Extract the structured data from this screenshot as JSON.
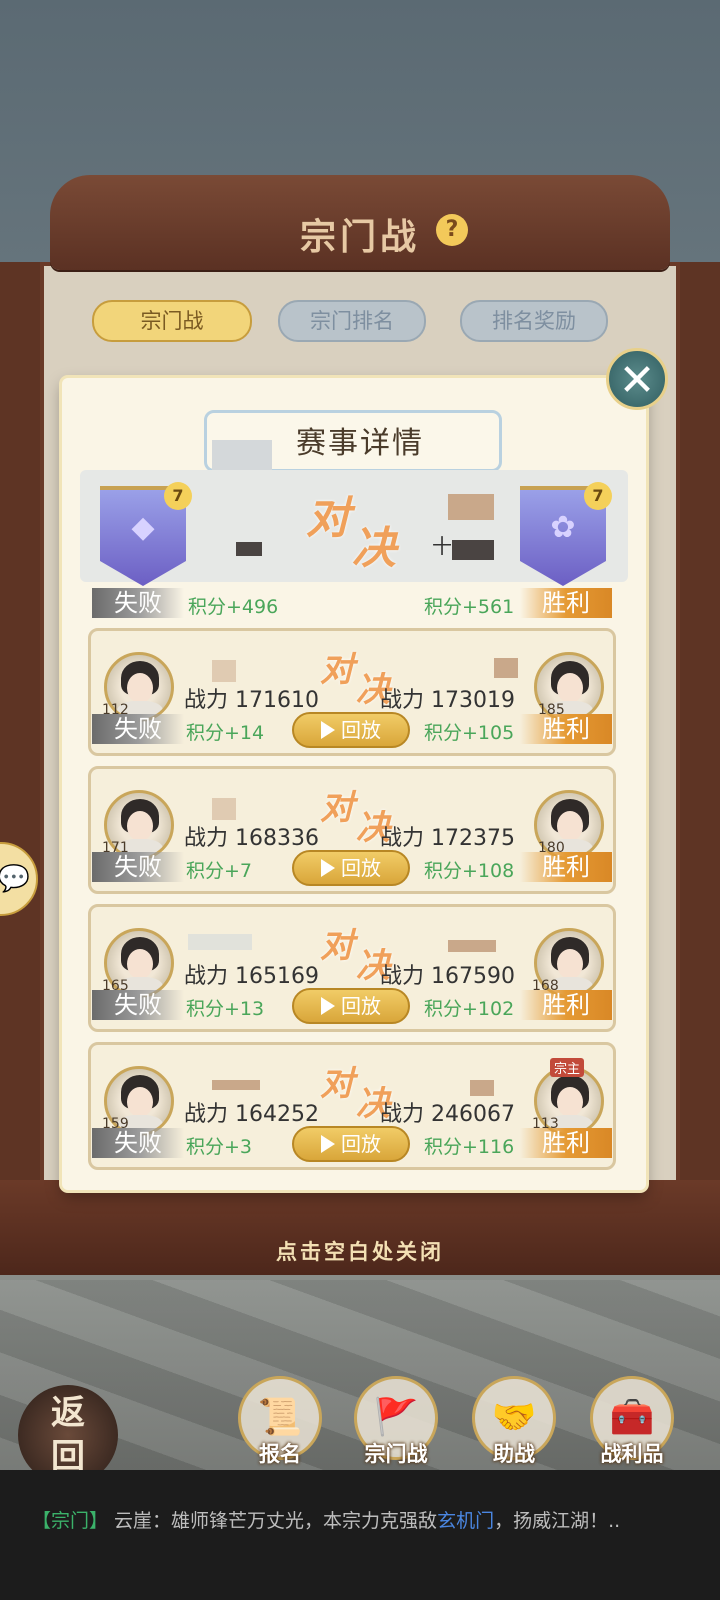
{
  "header": {
    "title": "宗门战",
    "help": "?"
  },
  "tabs": [
    {
      "label": "宗门战",
      "active": true
    },
    {
      "label": "宗门排名",
      "active": false
    },
    {
      "label": "排名奖励",
      "active": false
    }
  ],
  "dialog": {
    "title": "赛事详情",
    "close_hint": "点击空白处关闭",
    "summary": {
      "left": {
        "level": "7",
        "result": "失败",
        "points": "积分+496"
      },
      "right": {
        "level": "7",
        "result": "胜利",
        "points": "积分+561"
      },
      "vs_a": "对",
      "vs_b": "决",
      "right_name_fragment": "十"
    },
    "replay_label": "回放",
    "matches": [
      {
        "left": {
          "level": "112",
          "power": "战力 171610",
          "result": "失败",
          "points": "积分+14"
        },
        "right": {
          "level": "185",
          "power": "战力 173019",
          "result": "胜利",
          "points": "积分+105"
        }
      },
      {
        "left": {
          "level": "171",
          "power": "战力 168336",
          "result": "失败",
          "points": "积分+7"
        },
        "right": {
          "level": "180",
          "power": "战力 172375",
          "result": "胜利",
          "points": "积分+108"
        }
      },
      {
        "left": {
          "level": "165",
          "power": "战力 165169",
          "result": "失败",
          "points": "积分+13"
        },
        "right": {
          "level": "168",
          "power": "战力 167590",
          "result": "胜利",
          "points": "积分+102"
        }
      },
      {
        "left": {
          "level": "159",
          "power": "战力 164252",
          "result": "失败",
          "points": "积分+3"
        },
        "right": {
          "level": "113",
          "power": "战力 246067",
          "result": "胜利",
          "points": "积分+116",
          "badge": "宗主"
        }
      }
    ]
  },
  "nav": {
    "back": "返回",
    "items": [
      {
        "label": "报名",
        "icon": "scroll-brush-icon"
      },
      {
        "label": "宗门战",
        "icon": "flag-mountain-icon"
      },
      {
        "label": "助战",
        "icon": "handshake-icon"
      },
      {
        "label": "战利品",
        "icon": "treasure-chest-icon"
      }
    ]
  },
  "chat": {
    "channel": "【宗门】",
    "text_before": " 云崖：雄师锋芒万丈光，本宗力克强敌",
    "sect": "玄机门",
    "text_after": "，扬威江湖！.."
  },
  "colors": {
    "win": "#e59a34",
    "lose": "#8a8a8a",
    "points": "#4aa65a",
    "accent_gold": "#c9a65a"
  }
}
